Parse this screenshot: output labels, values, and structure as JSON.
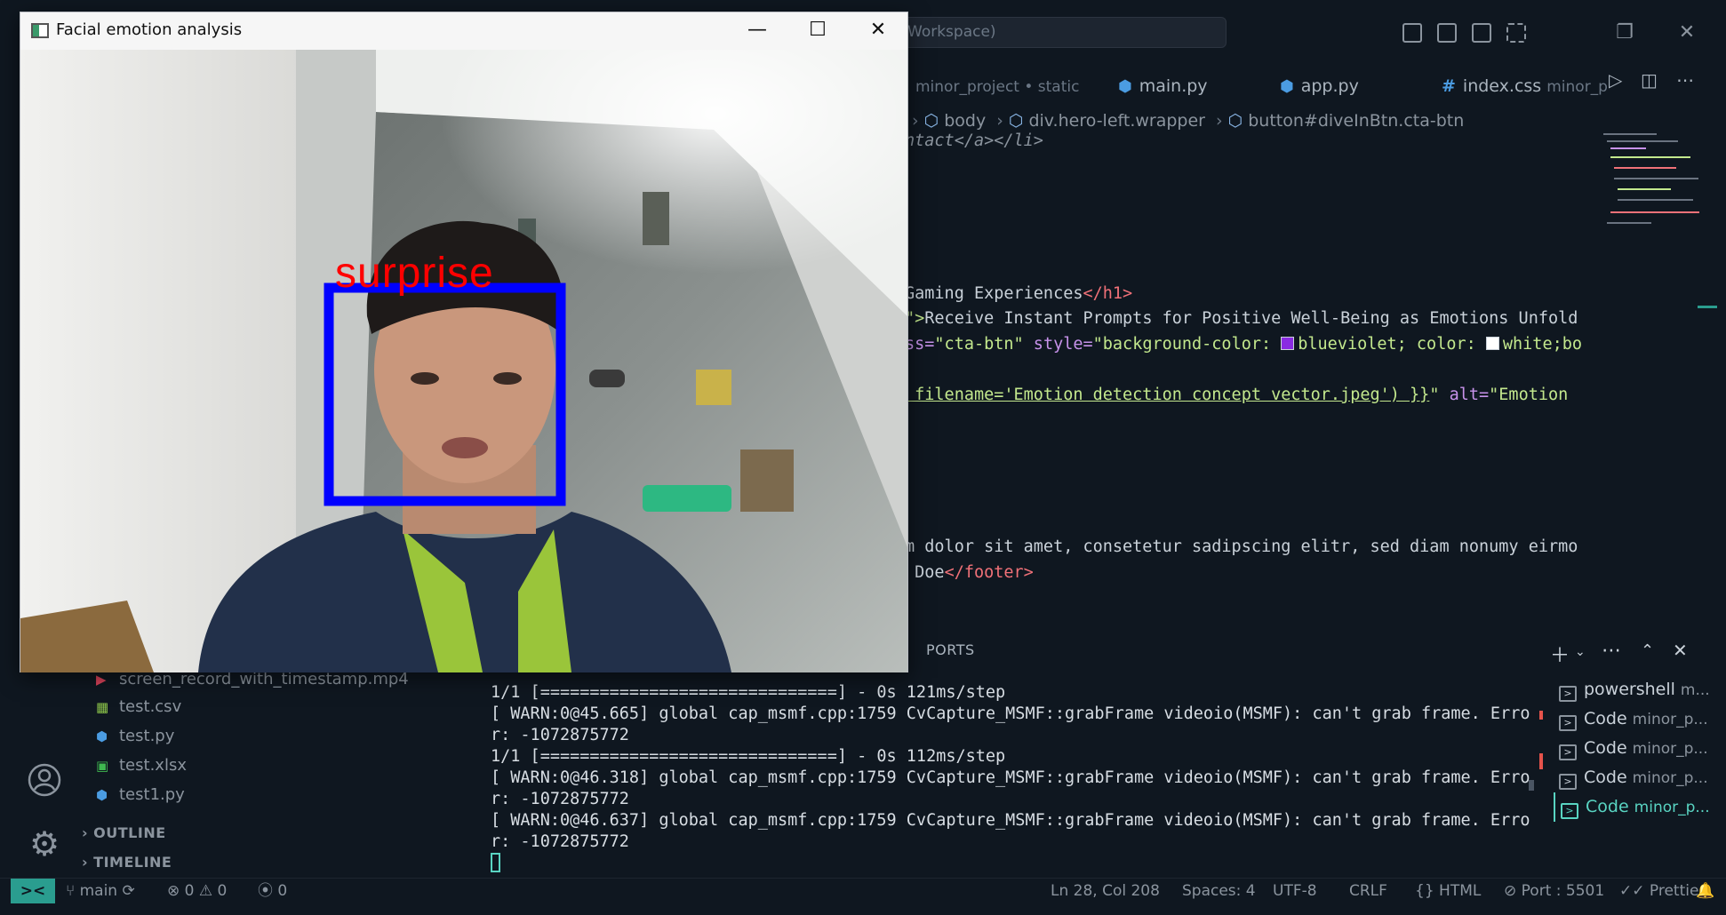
{
  "vscode": {
    "command_center": "Workspace)",
    "tabs": [
      {
        "label": "minor_project • static"
      },
      {
        "label": "main.py"
      },
      {
        "label": "app.py"
      },
      {
        "label": "index.css",
        "dim": "minor_p"
      }
    ],
    "breadcrumbs": [
      "body",
      "div.hero-left.wrapper",
      "button#diveInBtn.cta-btn"
    ],
    "code": {
      "l1": "ntact</a></li>",
      "l2a": "Gaming Experiences",
      "l2b": "</h1>",
      "l3a": "\">",
      "l3b": "Receive Instant Prompts for Positive Well-Being as Emotions Unfold",
      "l4a": "ss=",
      "l4b": "\"cta-btn\"",
      "l4c": " style=",
      "l4d": "\"background-color: ",
      "l4e": "blueviolet; color: ",
      "l4f": "white;bo",
      "l5a": " filename='Emotion detection concept vector.jpeg') }}",
      "l5b": "\"",
      "l5c": " alt=",
      "l5d": "\"Emotion",
      "l6": "m dolor sit amet, consetetur sadipscing elitr, sed diam nonumy eirmo",
      "l7a": " Doe",
      "l7b": "</footer>"
    },
    "swatch_colors": {
      "blueviolet": "#8a2be2",
      "white": "#ffffff"
    },
    "panel": {
      "title": "PORTS"
    },
    "sidebar": {
      "files": [
        {
          "name": "screen_record_with_timestamp.mp4",
          "icon": "video-file-icon"
        },
        {
          "name": "test.csv",
          "icon": "csv-file-icon"
        },
        {
          "name": "test.py",
          "icon": "python-file-icon"
        },
        {
          "name": "test.xlsx",
          "icon": "excel-file-icon"
        },
        {
          "name": "test1.py",
          "icon": "python-file-icon"
        }
      ],
      "outline": "OUTLINE",
      "timeline": "TIMELINE"
    },
    "terminal_lines": [
      "1/1 [==============================] - 0s 121ms/step",
      "[ WARN:0@45.665] global cap_msmf.cpp:1759 CvCapture_MSMF::grabFrame videoio(MSMF): can't grab frame. Erro",
      "r: -1072875772",
      "1/1 [==============================] - 0s 112ms/step",
      "[ WARN:0@46.318] global cap_msmf.cpp:1759 CvCapture_MSMF::grabFrame videoio(MSMF): can't grab frame. Erro",
      "r: -1072875772",
      "[ WARN:0@46.637] global cap_msmf.cpp:1759 CvCapture_MSMF::grabFrame videoio(MSMF): can't grab frame. Erro",
      "r: -1072875772"
    ],
    "terminals": [
      {
        "name": "powershell",
        "sub": "m..."
      },
      {
        "name": "Code",
        "sub": "minor_p..."
      },
      {
        "name": "Code",
        "sub": "minor_p..."
      },
      {
        "name": "Code",
        "sub": "minor_p..."
      },
      {
        "name": "Code",
        "sub": "minor_p...",
        "active": true
      }
    ],
    "statusbar": {
      "branch": "main",
      "errors": "0",
      "warnings": "0",
      "ports": "0",
      "cursor": "Ln 28, Col 208",
      "spaces": "Spaces: 4",
      "encoding": "UTF-8",
      "eol": "CRLF",
      "language": "HTML",
      "port": "Port : 5501",
      "prettier": "Prettier"
    }
  },
  "cv_window": {
    "title": "Facial emotion analysis",
    "emotion_label": "surprise",
    "label_color": "#ff0000",
    "box_color": "#0000ff"
  }
}
